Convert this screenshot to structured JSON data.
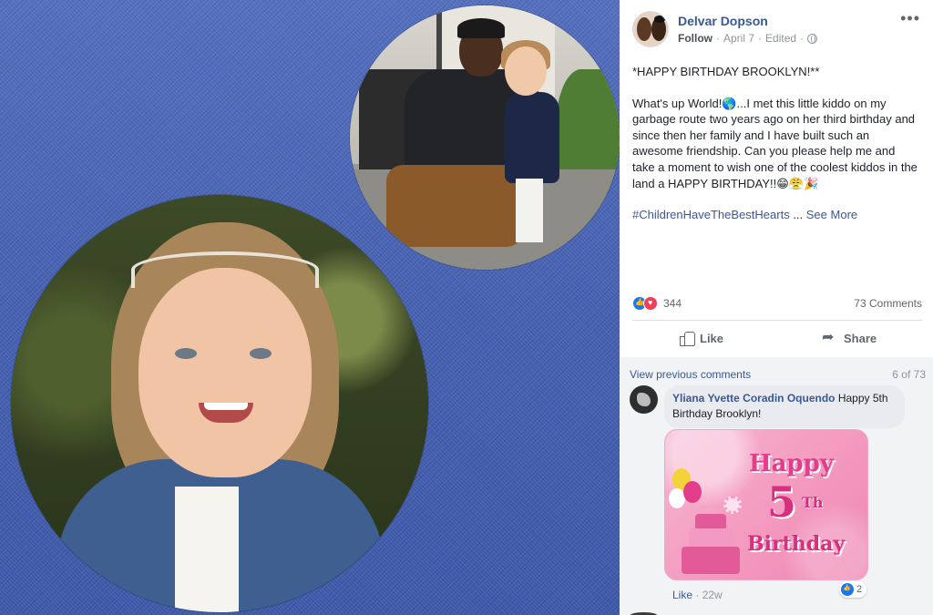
{
  "post": {
    "author": "Delvar Dopson",
    "follow": "Follow",
    "date": "April 7",
    "edited": "Edited",
    "more_icon": "ellipsis-icon",
    "paragraph1": "*HAPPY BIRTHDAY BROOKLYN!**",
    "paragraph2": "What's up World!🌎...I met this little kiddo on my garbage route two years ago on her third birthday and since then her family and I have built such an awesome friendship. Can you please help me and take a moment to wish one of the coolest kiddos in the land a HAPPY BIRTHDAY!!😁😤🎉",
    "hashtag": "#ChildrenHaveTheBestHearts",
    "ellipsis": " ... ",
    "see_more": "See More"
  },
  "reactions": {
    "count": "344",
    "comments": "73 Comments"
  },
  "actions": {
    "like": "Like",
    "share": "Share"
  },
  "comments": {
    "view_previous": "View previous comments",
    "pager": "6 of 73",
    "items": [
      {
        "name": "Yliana Yvette Coradin Oquendo",
        "text": "Happy 5th Birthday Brooklyn!",
        "sticker": {
          "line1": "Happy",
          "line2": "5",
          "line3": "Th",
          "line4": "Birthday"
        },
        "reaction_count": "2",
        "like": "Like",
        "time": "22w"
      }
    ]
  },
  "colors": {
    "link": "#385898",
    "denim": "#4865b6",
    "comment_bg": "#f2f3f5",
    "sticker_pink": "#f49cc0"
  }
}
